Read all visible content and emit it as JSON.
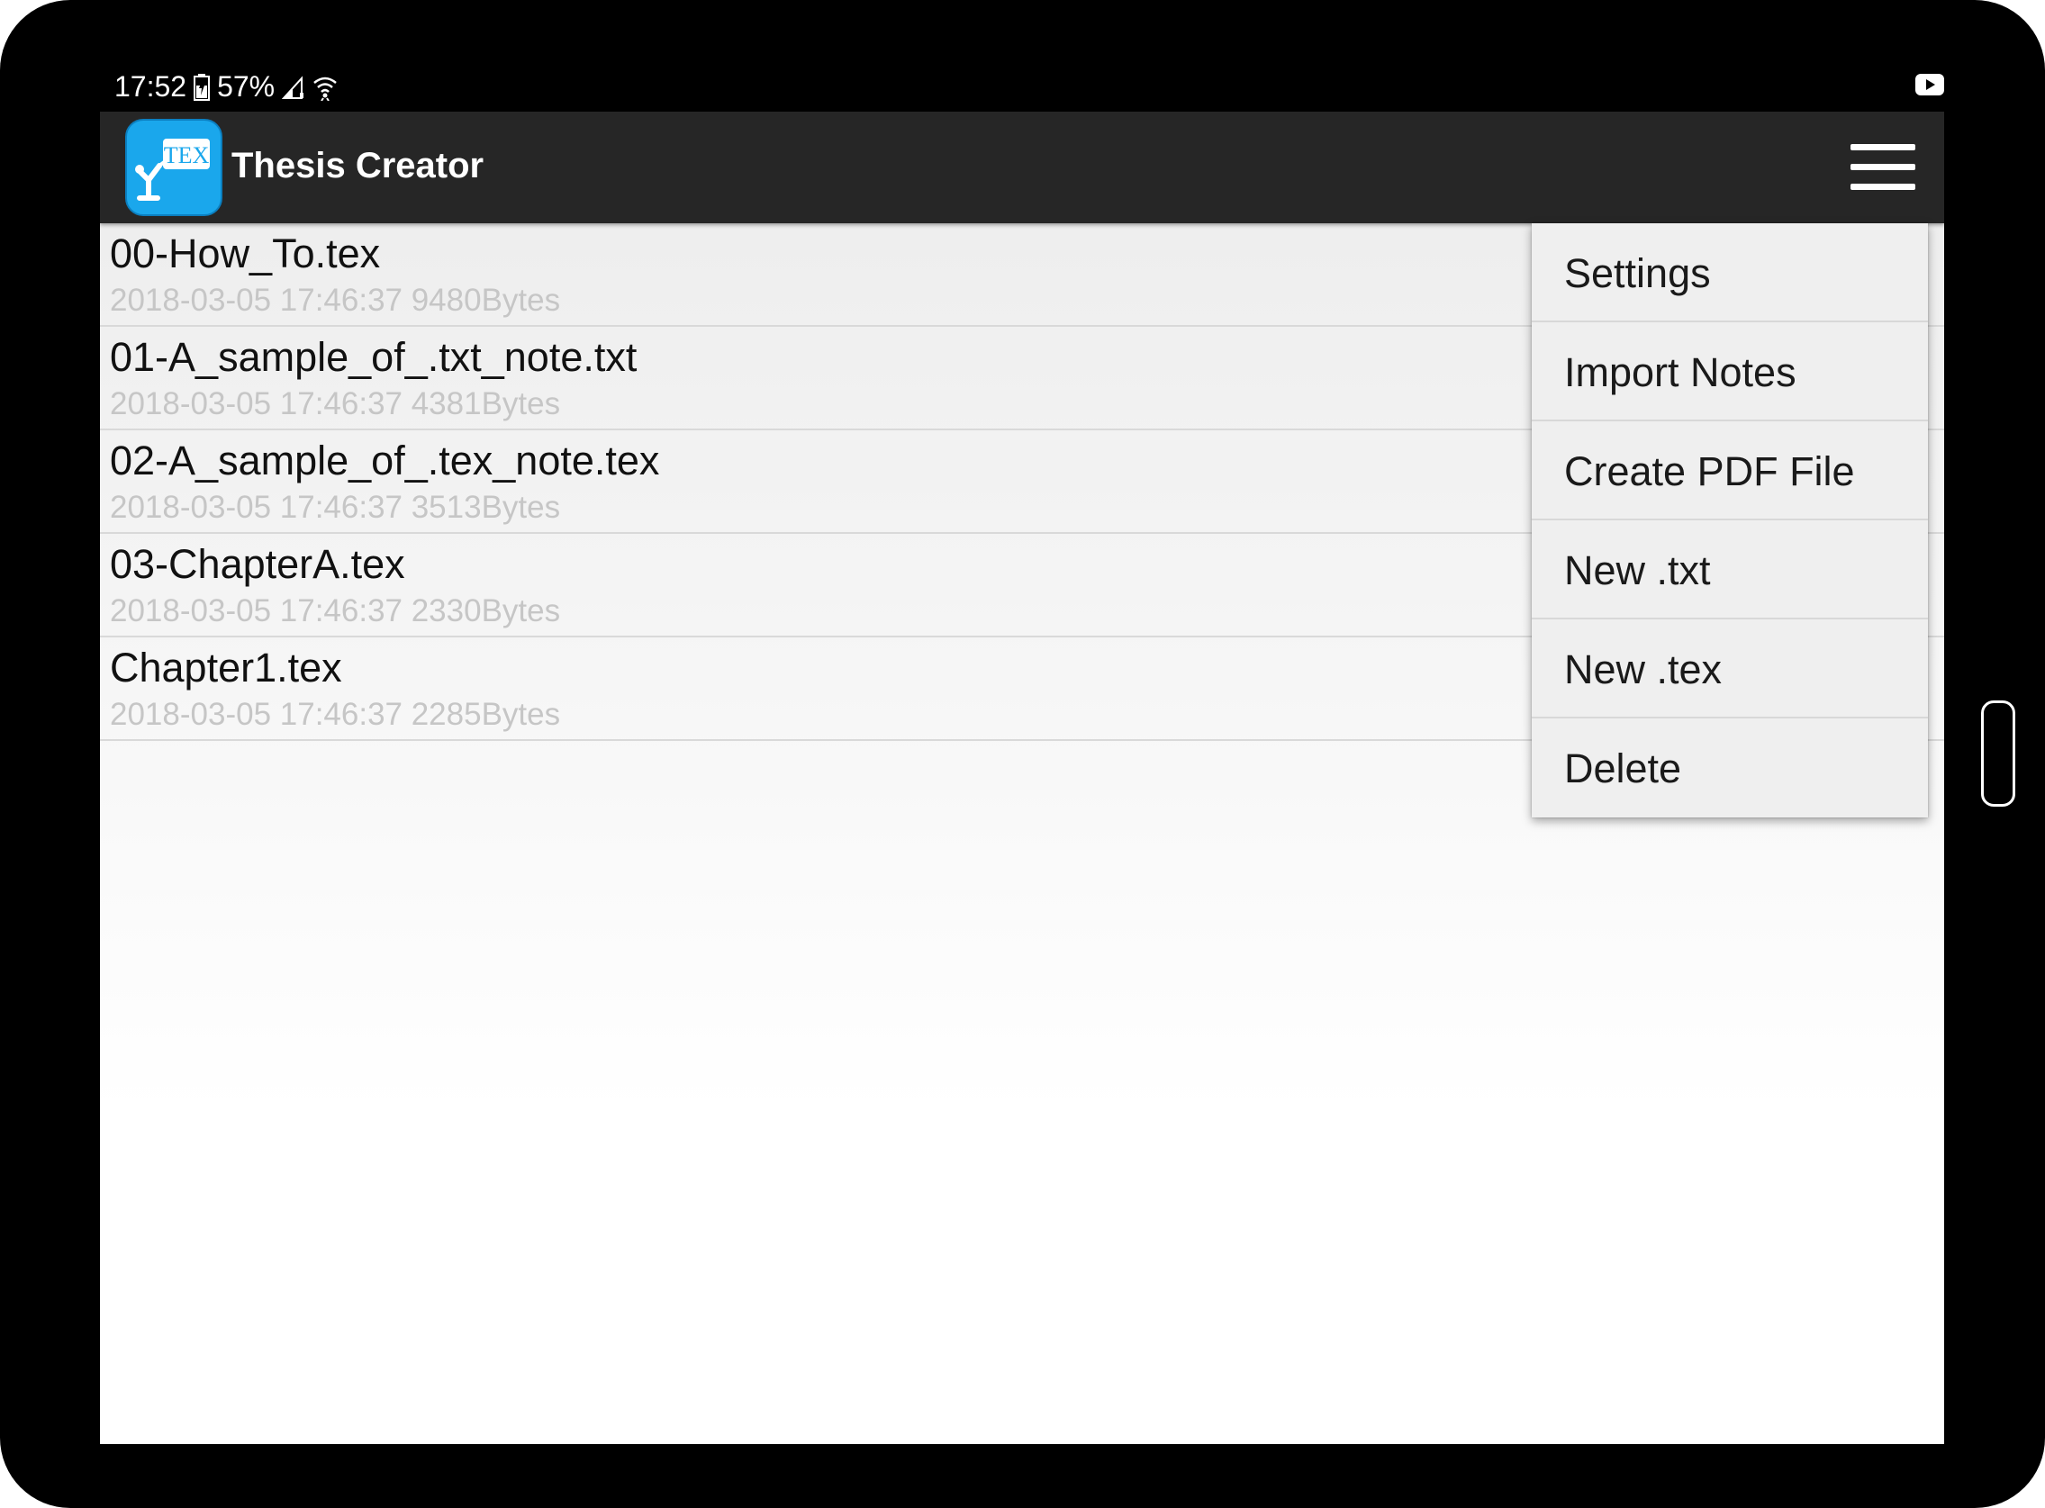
{
  "status_bar": {
    "time": "17:52",
    "battery": "57%",
    "icons": [
      "battery-icon",
      "signal-icon",
      "wifi-icon",
      "youtube-icon"
    ]
  },
  "app": {
    "title": "Thesis Creator",
    "logo_text": "TEX",
    "colors": {
      "appbar": "#262626",
      "logo": "#1aa7ec",
      "file_meta": "#c6c6c6"
    }
  },
  "files": [
    {
      "name": "00-How_To.tex",
      "meta": "2018-03-05 17:46:37 9480Bytes"
    },
    {
      "name": "01-A_sample_of_.txt_note.txt",
      "meta": "2018-03-05 17:46:37 4381Bytes"
    },
    {
      "name": "02-A_sample_of_.tex_note.tex",
      "meta": "2018-03-05 17:46:37 3513Bytes"
    },
    {
      "name": "03-ChapterA.tex",
      "meta": "2018-03-05 17:46:37 2330Bytes"
    },
    {
      "name": "Chapter1.tex",
      "meta": "2018-03-05 17:46:37 2285Bytes"
    }
  ],
  "menu": {
    "items": [
      {
        "label": "Settings"
      },
      {
        "label": "Import Notes"
      },
      {
        "label": "Create PDF File"
      },
      {
        "label": "New .txt"
      },
      {
        "label": "New .tex"
      },
      {
        "label": "Delete"
      }
    ]
  }
}
